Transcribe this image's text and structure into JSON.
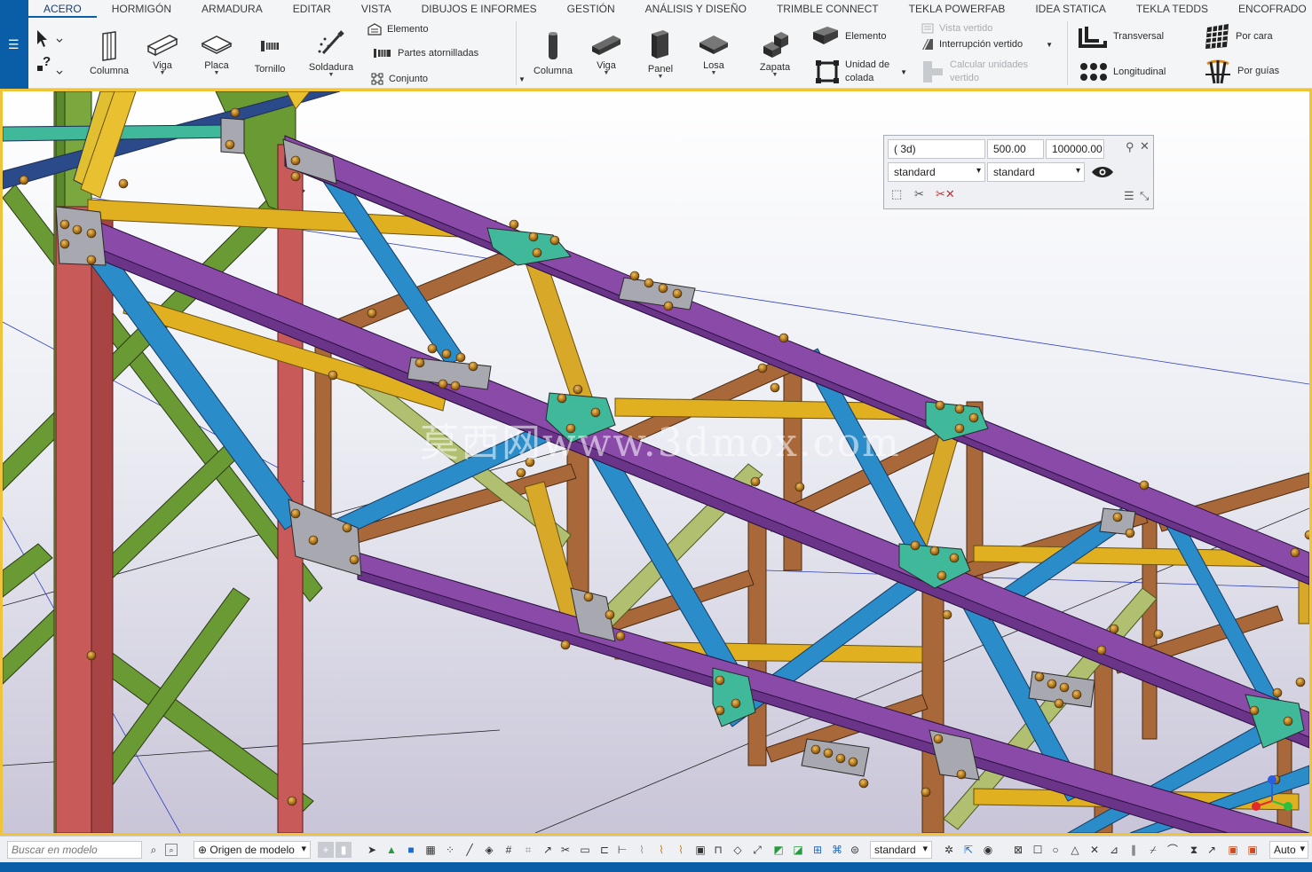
{
  "menu_tabs": [
    "ACERO",
    "HORMIGÓN",
    "ARMADURA",
    "EDITAR",
    "VISTA",
    "DIBUJOS E INFORMES",
    "GESTIÓN",
    "ANÁLISIS Y DISEÑO",
    "TRIMBLE CONNECT",
    "TEKLA POWERFAB",
    "IDEA STATICA",
    "TEKLA TEDDS",
    "ENCOFRADO"
  ],
  "active_tab": "ACERO",
  "steel": {
    "columna": "Columna",
    "viga": "Viga",
    "placa": "Placa",
    "tornillo": "Tornillo",
    "soldadura": "Soldadura",
    "elemento": "Elemento",
    "partes_atornilladas": "Partes atornilladas",
    "conjunto": "Conjunto"
  },
  "concrete": {
    "columna": "Columna",
    "viga": "Viga",
    "panel": "Panel",
    "losa": "Losa",
    "zapata": "Zapata",
    "elemento": "Elemento",
    "unidad_colada_1": "Unidad de",
    "unidad_colada_2": "colada",
    "vista_vertido": "Vista vertido",
    "interrupcion_vertido": "Interrupción vertido",
    "calcular_unidades_1": "Calcular unidades",
    "calcular_unidades_2": "vertido"
  },
  "rebar": {
    "transversal": "Transversal",
    "longitudinal": "Longitudinal",
    "por_cara": "Por cara",
    "por_guias": "Por guías"
  },
  "view_panel": {
    "view_name": "( 3d)",
    "depth_value": "500.00",
    "far_value": "100000.00",
    "filter_1": "standard",
    "filter_2": "standard"
  },
  "status_bar": {
    "search_placeholder": "Buscar en modelo",
    "origin_label": "Origen de modelo",
    "standard_select": "standard",
    "auto_select": "Auto"
  },
  "watermark": "莫西网www.3dmox.com",
  "colors": {
    "brand_blue": "#0a5ea8",
    "viewport_border": "#f0c43a",
    "purple_beam": "#8a4aa8",
    "blue_brace": "#2a8cc8",
    "yellow_beam": "#e0b020",
    "brown_member": "#a8683a",
    "green_member": "#6a9a34",
    "red_column": "#c85a5a",
    "teal_plate": "#40b89a"
  }
}
